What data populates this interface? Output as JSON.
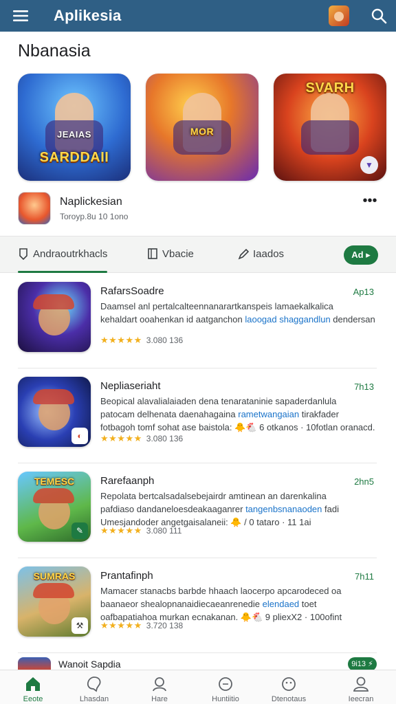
{
  "appbar": {
    "title": "Aplikesia",
    "menu_icon": "menu-icon",
    "search_icon": "search-icon"
  },
  "section": {
    "title": "Nbanasia"
  },
  "featured": [
    {
      "label": "SARDDAII",
      "sub": "JEAIAS"
    },
    {
      "label": "MOR"
    },
    {
      "label": "SVARH"
    }
  ],
  "app": {
    "name": "Naplickesian",
    "subtitle": "Toroyp.8u 10 1ono"
  },
  "tabs": [
    {
      "label": "Andraoutrkhacls",
      "icon": "shield-icon"
    },
    {
      "label": "Vbacie",
      "icon": "book-icon"
    },
    {
      "label": "Iaados",
      "icon": "pen-icon"
    }
  ],
  "add_button": "Ad",
  "items": [
    {
      "title": "RafarsSoadre",
      "time": "Ap13",
      "desc_1": "Daamsel anl pertalcalteennanarartkanspeis lamaekalkalica",
      "desc_2a": "kehaldart ooahenkan id aatganchon ",
      "desc_2b": "laoogad shaggandlun",
      "desc_2c": " dendersan",
      "desc_3": "",
      "rating": "3.080 136"
    },
    {
      "title": "Nepliaseriaht",
      "time": "7h13",
      "desc_1": "Beopical alavalialaiaden dena tenarataninie sapaderdanlula",
      "desc_2a": "patocam delhenata daenahagaina ",
      "desc_2b": "rametwangaian",
      "desc_2c": " tirakfader",
      "desc_3": "fotbagoh tomf sohat ase baistola: 🐥🐔 6 otkanos · 10fotlan oranacd.",
      "rating": "3.080 136"
    },
    {
      "title": "Rarefaanph",
      "time": "2hn5",
      "desc_1": "Repolata bertcalsadalsebejairdr amtinean an darenkalina",
      "desc_2a": "pafdiaso dandaneloesdeakaaganrer ",
      "desc_2b": "tangenbsnanaoden",
      "desc_2c": " fadi",
      "desc_3": "Umesjandoder angetgaisalaneii: 🐥 / 0 tataro · 11 1ai",
      "rating": "3.080 111"
    },
    {
      "title": "Prantafinph",
      "time": "7h11",
      "desc_1": "Mamacer stanacbs barbde hhaach laocerpo apcarodeced oa",
      "desc_2a": "baanaeor shealopnanaidiecaeanrenedie ",
      "desc_2b": "elendaed",
      "desc_2c": " toet",
      "desc_3": "oafbapatiahoa murkan ecnakanan. 🐥🐔 9 pliexX2 · 100ofint",
      "rating": "3.720 138"
    }
  ],
  "icon_caps": [
    "",
    "",
    "TEMESC",
    "SUMRAS"
  ],
  "last": {
    "title": "Wanoit Sapdia",
    "button": "9i13 ⚡"
  },
  "nav": [
    {
      "label": "Eeote",
      "icon": "home-icon"
    },
    {
      "label": "Lhasdan",
      "icon": "chat-icon"
    },
    {
      "label": "Hare",
      "icon": "user-icon"
    },
    {
      "label": "Huntiitio",
      "icon": "circle-icon"
    },
    {
      "label": "Dtenotaus",
      "icon": "smile-icon"
    },
    {
      "label": "Ieecran",
      "icon": "profile-icon"
    }
  ],
  "colors": {
    "appbar": "#2f5f85",
    "accent": "#1e7a42",
    "link": "#1a73c9",
    "star": "#f2b01e"
  }
}
